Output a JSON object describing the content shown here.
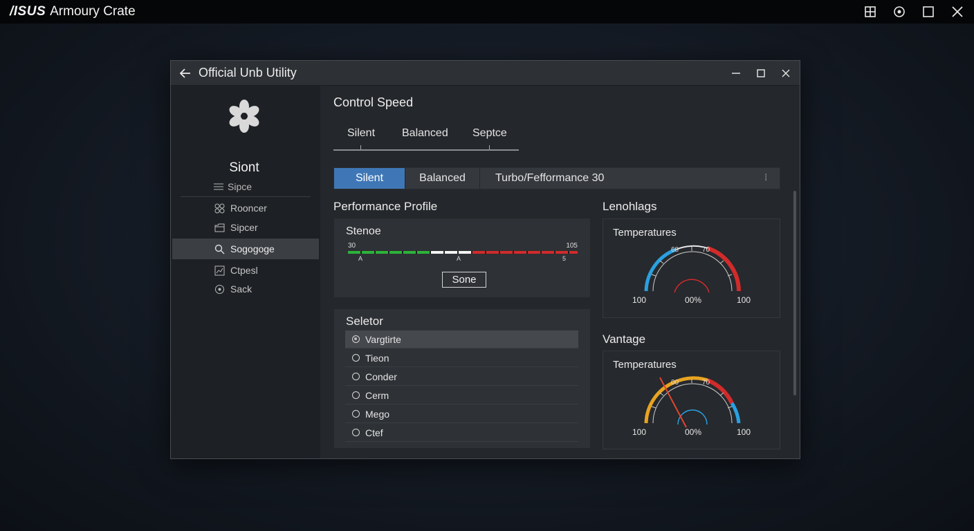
{
  "app": {
    "logo": "/ISUS",
    "title": "Armoury Crate"
  },
  "window": {
    "title": "Official Unb Utility"
  },
  "sidebar": {
    "title": "Siont",
    "subtitle": "Sipce",
    "items": [
      {
        "label": "Rooncer",
        "icon": "cluster-icon"
      },
      {
        "label": "Sipcer",
        "icon": "folder-icon"
      },
      {
        "label": "Sogogoge",
        "icon": "search-icon",
        "active": true
      },
      {
        "label": "Ctpesl",
        "icon": "chart-icon"
      },
      {
        "label": "Sack",
        "icon": "target-icon"
      }
    ]
  },
  "control_speed": {
    "title": "Control Speed",
    "tabs": [
      "Silent",
      "Balanced",
      "Septce"
    ]
  },
  "mode_selector": {
    "silent": "Silent",
    "balanced": "Balanced",
    "turbo": "Turbo/Fefformance 30",
    "caret": "⁞"
  },
  "performance_profile": {
    "label": "Performance Profile",
    "panel_title": "Stenoe",
    "min_label": "30",
    "max_label": "105",
    "mark_left": "A",
    "mark_mid": "A",
    "mark_right": "5",
    "button": "Sone"
  },
  "selector": {
    "title": "Seletor",
    "options": [
      {
        "label": "Vargtirte",
        "selected": true
      },
      {
        "label": "Tieon",
        "selected": false
      },
      {
        "label": "Conder",
        "selected": false
      },
      {
        "label": "Cerm",
        "selected": false
      },
      {
        "label": "Mego",
        "selected": false
      },
      {
        "label": "Ctef",
        "selected": false
      }
    ]
  },
  "gauge_top": {
    "section": "Lenohlags",
    "title": "Temperatures",
    "tick_a": "60",
    "tick_b": "70",
    "left": "100",
    "center": "00%",
    "right": "100"
  },
  "gauge_bottom": {
    "section": "Vantage",
    "title": "Temperatures",
    "tick_a": "00",
    "tick_b": "70",
    "left": "100",
    "center": "00%",
    "right": "100"
  },
  "colors": {
    "accent": "#3f77b6",
    "green": "#2db33a",
    "red": "#d12b2b",
    "blue_arc": "#2aa0e0",
    "orange_arc": "#e8a420"
  }
}
